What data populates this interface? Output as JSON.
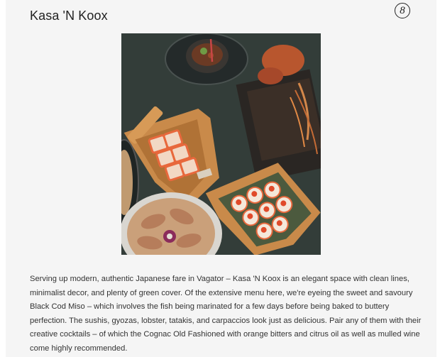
{
  "article": {
    "title": "Kasa 'N Koox",
    "rank": "8",
    "description": "Serving up modern, authentic Japanese fare in Vagator – Kasa 'N Koox is an elegant space with clean lines, minimalist decor, and plenty of green cover. Of the extensive menu here, we're eyeing the sweet and savoury Black Cod Miso – which involves the fish being marinated for a few days before being baked to buttery perfection. The sushis, gyozas, lobster, tatakis, and carpaccios look just as delicious. Pair any of them with their creative cocktails – of which the Cognac Old Fashioned with orange bitters and citrus oil as well as mulled wine come highly recommended."
  },
  "colors": {
    "card_background": "#f5f5f5",
    "table_dark": "#2f3a37",
    "wood": "#c98a4a",
    "salmon": "#e8683c"
  }
}
